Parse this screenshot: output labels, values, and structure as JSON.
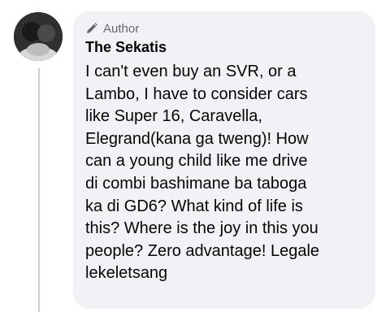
{
  "comment": {
    "badge_label": "Author",
    "author_name": "The Sekatis",
    "text": "I can't even buy an SVR, or a\nLambo, I have to consider cars\nlike Super 16, Caravella,\nElegrand(kana ga tweng)! How\ncan a young child like me drive\ndi combi bashimane ba taboga\nka di GD6? What kind of life is\nthis? Where is the joy in this you\npeople? Zero advantage! Legale\nlekeletsang"
  },
  "icons": {
    "badge": "pencil-icon"
  },
  "colors": {
    "bubble_bg": "#f0f2f5",
    "secondary_text": "#65676b",
    "primary_text": "#050505",
    "thread_line": "#ced0d4"
  }
}
